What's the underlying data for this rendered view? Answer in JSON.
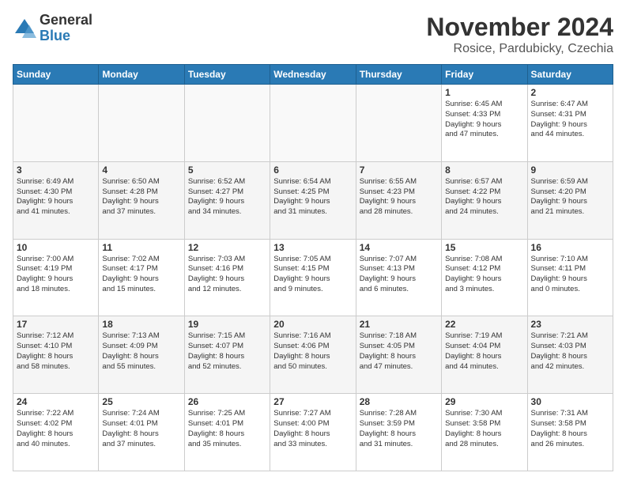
{
  "logo": {
    "general": "General",
    "blue": "Blue"
  },
  "header": {
    "month": "November 2024",
    "location": "Rosice, Pardubicky, Czechia"
  },
  "weekdays": [
    "Sunday",
    "Monday",
    "Tuesday",
    "Wednesday",
    "Thursday",
    "Friday",
    "Saturday"
  ],
  "weeks": [
    [
      {
        "day": "",
        "info": ""
      },
      {
        "day": "",
        "info": ""
      },
      {
        "day": "",
        "info": ""
      },
      {
        "day": "",
        "info": ""
      },
      {
        "day": "",
        "info": ""
      },
      {
        "day": "1",
        "info": "Sunrise: 6:45 AM\nSunset: 4:33 PM\nDaylight: 9 hours\nand 47 minutes."
      },
      {
        "day": "2",
        "info": "Sunrise: 6:47 AM\nSunset: 4:31 PM\nDaylight: 9 hours\nand 44 minutes."
      }
    ],
    [
      {
        "day": "3",
        "info": "Sunrise: 6:49 AM\nSunset: 4:30 PM\nDaylight: 9 hours\nand 41 minutes."
      },
      {
        "day": "4",
        "info": "Sunrise: 6:50 AM\nSunset: 4:28 PM\nDaylight: 9 hours\nand 37 minutes."
      },
      {
        "day": "5",
        "info": "Sunrise: 6:52 AM\nSunset: 4:27 PM\nDaylight: 9 hours\nand 34 minutes."
      },
      {
        "day": "6",
        "info": "Sunrise: 6:54 AM\nSunset: 4:25 PM\nDaylight: 9 hours\nand 31 minutes."
      },
      {
        "day": "7",
        "info": "Sunrise: 6:55 AM\nSunset: 4:23 PM\nDaylight: 9 hours\nand 28 minutes."
      },
      {
        "day": "8",
        "info": "Sunrise: 6:57 AM\nSunset: 4:22 PM\nDaylight: 9 hours\nand 24 minutes."
      },
      {
        "day": "9",
        "info": "Sunrise: 6:59 AM\nSunset: 4:20 PM\nDaylight: 9 hours\nand 21 minutes."
      }
    ],
    [
      {
        "day": "10",
        "info": "Sunrise: 7:00 AM\nSunset: 4:19 PM\nDaylight: 9 hours\nand 18 minutes."
      },
      {
        "day": "11",
        "info": "Sunrise: 7:02 AM\nSunset: 4:17 PM\nDaylight: 9 hours\nand 15 minutes."
      },
      {
        "day": "12",
        "info": "Sunrise: 7:03 AM\nSunset: 4:16 PM\nDaylight: 9 hours\nand 12 minutes."
      },
      {
        "day": "13",
        "info": "Sunrise: 7:05 AM\nSunset: 4:15 PM\nDaylight: 9 hours\nand 9 minutes."
      },
      {
        "day": "14",
        "info": "Sunrise: 7:07 AM\nSunset: 4:13 PM\nDaylight: 9 hours\nand 6 minutes."
      },
      {
        "day": "15",
        "info": "Sunrise: 7:08 AM\nSunset: 4:12 PM\nDaylight: 9 hours\nand 3 minutes."
      },
      {
        "day": "16",
        "info": "Sunrise: 7:10 AM\nSunset: 4:11 PM\nDaylight: 9 hours\nand 0 minutes."
      }
    ],
    [
      {
        "day": "17",
        "info": "Sunrise: 7:12 AM\nSunset: 4:10 PM\nDaylight: 8 hours\nand 58 minutes."
      },
      {
        "day": "18",
        "info": "Sunrise: 7:13 AM\nSunset: 4:09 PM\nDaylight: 8 hours\nand 55 minutes."
      },
      {
        "day": "19",
        "info": "Sunrise: 7:15 AM\nSunset: 4:07 PM\nDaylight: 8 hours\nand 52 minutes."
      },
      {
        "day": "20",
        "info": "Sunrise: 7:16 AM\nSunset: 4:06 PM\nDaylight: 8 hours\nand 50 minutes."
      },
      {
        "day": "21",
        "info": "Sunrise: 7:18 AM\nSunset: 4:05 PM\nDaylight: 8 hours\nand 47 minutes."
      },
      {
        "day": "22",
        "info": "Sunrise: 7:19 AM\nSunset: 4:04 PM\nDaylight: 8 hours\nand 44 minutes."
      },
      {
        "day": "23",
        "info": "Sunrise: 7:21 AM\nSunset: 4:03 PM\nDaylight: 8 hours\nand 42 minutes."
      }
    ],
    [
      {
        "day": "24",
        "info": "Sunrise: 7:22 AM\nSunset: 4:02 PM\nDaylight: 8 hours\nand 40 minutes."
      },
      {
        "day": "25",
        "info": "Sunrise: 7:24 AM\nSunset: 4:01 PM\nDaylight: 8 hours\nand 37 minutes."
      },
      {
        "day": "26",
        "info": "Sunrise: 7:25 AM\nSunset: 4:01 PM\nDaylight: 8 hours\nand 35 minutes."
      },
      {
        "day": "27",
        "info": "Sunrise: 7:27 AM\nSunset: 4:00 PM\nDaylight: 8 hours\nand 33 minutes."
      },
      {
        "day": "28",
        "info": "Sunrise: 7:28 AM\nSunset: 3:59 PM\nDaylight: 8 hours\nand 31 minutes."
      },
      {
        "day": "29",
        "info": "Sunrise: 7:30 AM\nSunset: 3:58 PM\nDaylight: 8 hours\nand 28 minutes."
      },
      {
        "day": "30",
        "info": "Sunrise: 7:31 AM\nSunset: 3:58 PM\nDaylight: 8 hours\nand 26 minutes."
      }
    ]
  ]
}
